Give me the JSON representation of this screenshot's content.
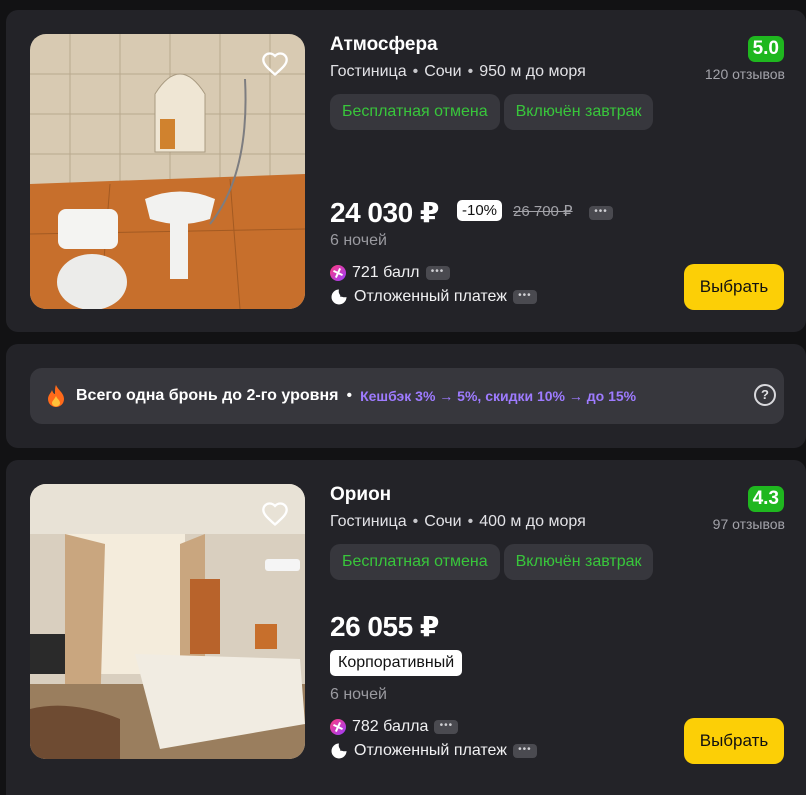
{
  "hotels": [
    {
      "name": "Атмосфера",
      "type": "Гостиница",
      "city": "Сочи",
      "distance": "950 м до моря",
      "rating": "5.0",
      "reviews": "120 отзывов",
      "tags": [
        "Бесплатная отмена",
        "Включён завтрак"
      ],
      "price": "24 030 ₽",
      "discount": "-10%",
      "old_price": "26 700 ₽",
      "nights": "6 ночей",
      "points": "721 балл",
      "deferred": "Отложенный платеж",
      "button": "Выбрать"
    },
    {
      "name": "Орион",
      "type": "Гостиница",
      "city": "Сочи",
      "distance": "400 м до моря",
      "rating": "4.3",
      "reviews": "97 отзывов",
      "tags": [
        "Бесплатная отмена",
        "Включён завтрак"
      ],
      "price": "26 055 ₽",
      "badge": "Корпоративный",
      "nights": "6 ночей",
      "points": "782 балла",
      "deferred": "Отложенный платеж",
      "button": "Выбрать"
    }
  ],
  "promo": {
    "text": "Всего одна бронь до 2-го уровня",
    "separator": "•",
    "sub": "Кешбэк 3% → 5%, скидки 10% → до 15%",
    "help": "?"
  },
  "icons": {
    "favorite": "heart-icon",
    "points": "plus-points-icon",
    "deferred": "moon-clock-icon",
    "promo": "flame-icon",
    "help": "question-icon"
  },
  "colors": {
    "rating": "#1fb71f",
    "tag_text": "#38c63b",
    "button": "#fccf06",
    "promo_sub": "#9e7bff"
  }
}
